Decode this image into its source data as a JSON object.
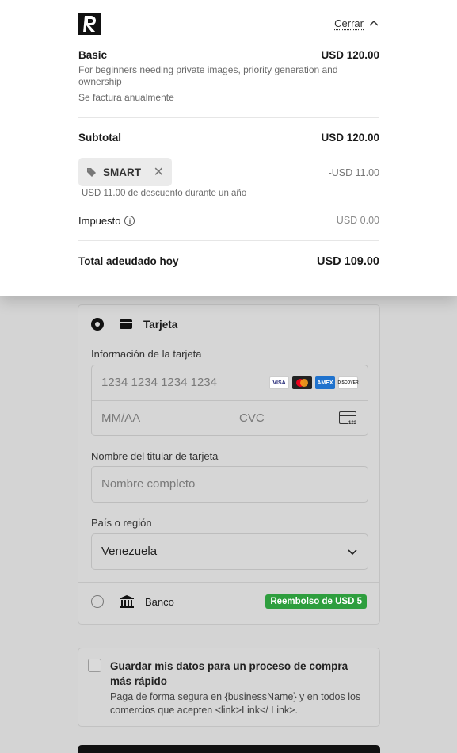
{
  "header": {
    "logo_alt": "R logo",
    "close_label": "Cerrar"
  },
  "plan": {
    "name": "Basic",
    "price": "USD 120.00",
    "description": "For beginners needing private images, priority generation and ownership",
    "billing": "Se factura anualmente"
  },
  "subtotal": {
    "label": "Subtotal",
    "value": "USD 120.00"
  },
  "promo": {
    "code": "SMART",
    "amount": "-USD 11.00",
    "note": "USD 11.00 de descuento durante un año"
  },
  "tax": {
    "label": "Impuesto",
    "value": "USD 0.00"
  },
  "total": {
    "label": "Total adeudado hoy",
    "value": "USD 109.00"
  },
  "payment": {
    "card_method_label": "Tarjeta",
    "card_info_label": "Información de la tarjeta",
    "card_number_placeholder": "1234 1234 1234 1234",
    "expiry_placeholder": "MM/AA",
    "cvc_placeholder": "CVC",
    "cvc_icon_text": "123",
    "brands": [
      "VISA",
      "Mastercard",
      "AMEX",
      "DISCOVER"
    ],
    "holder_label": "Nombre del titular de tarjeta",
    "holder_placeholder": "Nombre completo",
    "country_label": "País o región",
    "country_value": "Venezuela",
    "bank_method_label": "Banco",
    "bank_badge": "Reembolso de USD 5"
  },
  "save_info": {
    "title": "Guardar mis datos para un proceso de compra más rápido",
    "description": "Paga de forma segura en {businessName} y en todos los comercios que acepten <link>Link</ Link>."
  },
  "colors": {
    "overlay": "#d4d4d4",
    "badge_green": "#2e9e3e",
    "primary_dark": "#111111"
  }
}
